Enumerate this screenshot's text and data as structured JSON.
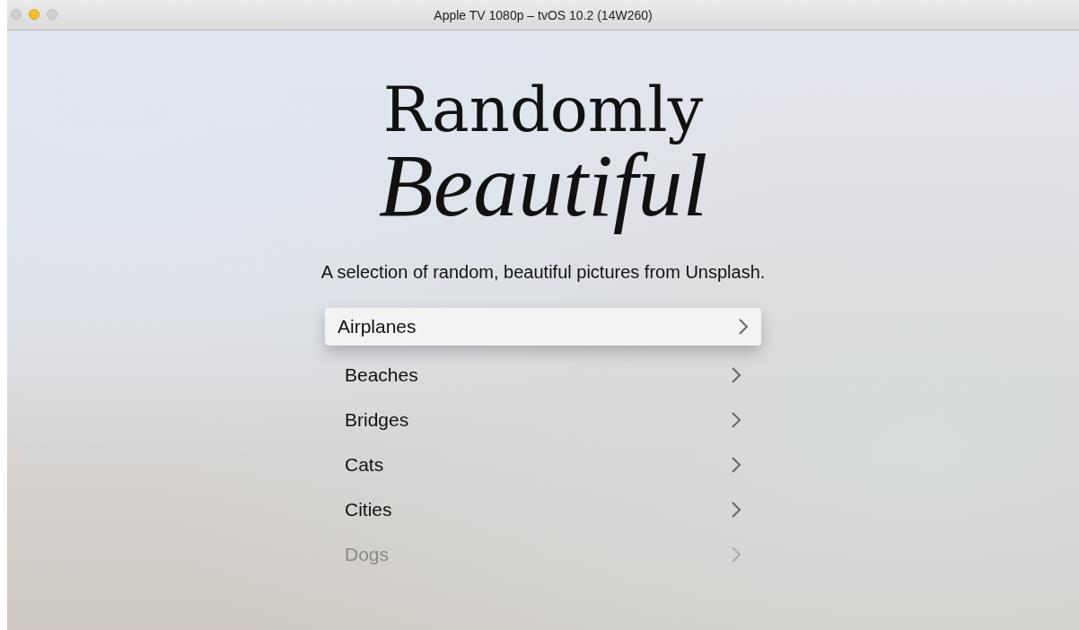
{
  "window": {
    "title": "Apple TV 1080p – tvOS 10.2 (14W260)"
  },
  "logo": {
    "line_1": "Randomly",
    "line_2": "Beautiful"
  },
  "subtitle": "A selection of random, beautiful pictures from Unsplash.",
  "categories": [
    {
      "label": "Airplanes",
      "selected": true,
      "faded": false
    },
    {
      "label": "Beaches",
      "selected": false,
      "faded": false
    },
    {
      "label": "Bridges",
      "selected": false,
      "faded": false
    },
    {
      "label": "Cats",
      "selected": false,
      "faded": false
    },
    {
      "label": "Cities",
      "selected": false,
      "faded": false
    },
    {
      "label": "Dogs",
      "selected": false,
      "faded": true
    }
  ]
}
